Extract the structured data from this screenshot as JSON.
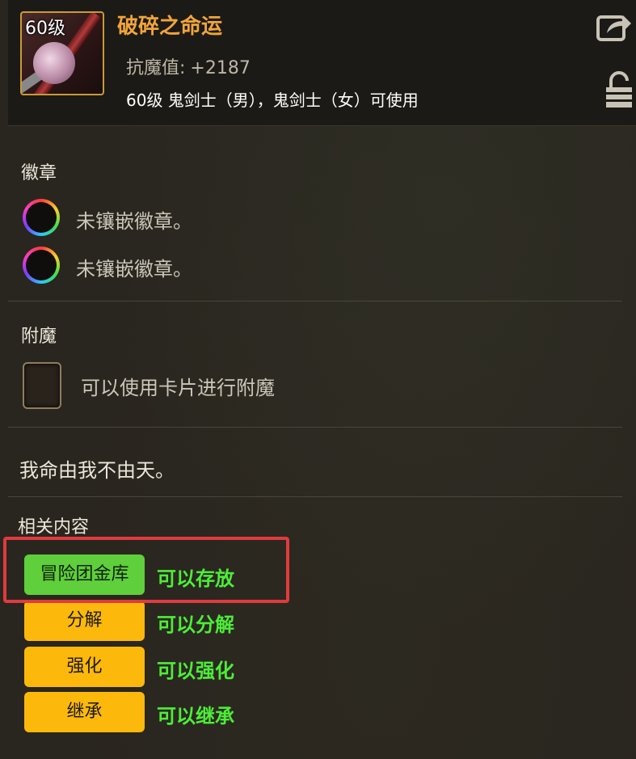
{
  "item": {
    "level_badge": "60级",
    "name": "破碎之命运",
    "stat_label": "抗魔值:",
    "stat_value": "+2187",
    "usable_by": "60级 鬼剑士（男），鬼剑士（女）可使用"
  },
  "icons": {
    "item": "sword-item-icon",
    "share": "share-icon",
    "lock": "lock-icon",
    "badge_slot": "badge-slot-icon",
    "card_slot": "card-slot-icon"
  },
  "sections": {
    "badges": {
      "title": "徽章",
      "slots": [
        {
          "text": "未镶嵌徽章。"
        },
        {
          "text": "未镶嵌徽章。"
        }
      ]
    },
    "enchant": {
      "title": "附魔",
      "text": "可以使用卡片进行附魔"
    },
    "flavor_text": "我命由我不由天。",
    "related": {
      "title": "相关内容",
      "rows": [
        {
          "button": "冒险团金库",
          "status": "可以存放",
          "color": "#5fcf3b"
        },
        {
          "button": "分解",
          "status": "可以分解",
          "color": "#fcb90b"
        },
        {
          "button": "强化",
          "status": "可以强化",
          "color": "#fcb90b"
        },
        {
          "button": "继承",
          "status": "可以继承",
          "color": "#fcb90b"
        }
      ]
    }
  },
  "colors": {
    "item_name": "#f1a53a",
    "status_green": "#4ded38",
    "highlight": "#e03a3f"
  }
}
